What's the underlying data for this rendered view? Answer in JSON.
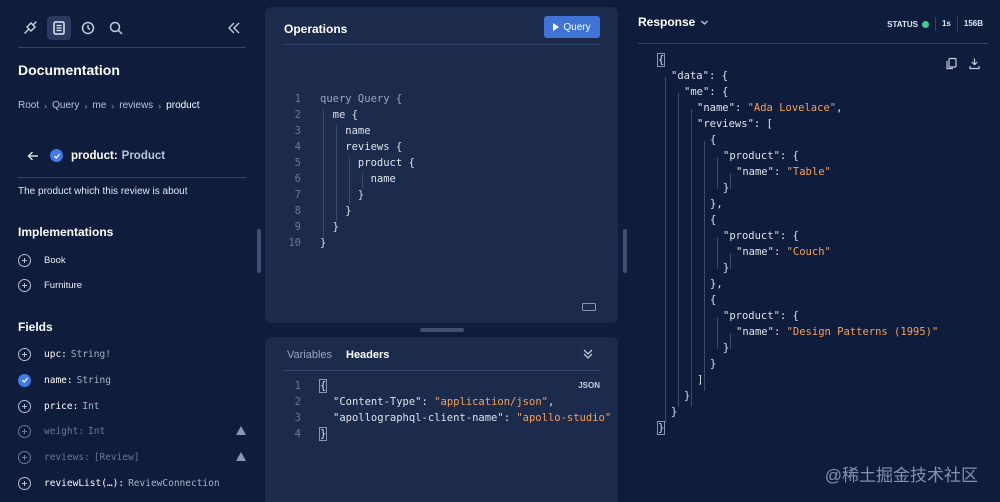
{
  "docs": {
    "toolbar": [
      "explorer-icon",
      "docs-icon",
      "history-icon",
      "search-icon",
      "collapse-icon"
    ],
    "title": "Documentation",
    "breadcrumb": [
      "Root",
      "Query",
      "me",
      "reviews",
      "product"
    ],
    "field": {
      "name": "product",
      "type": "Product"
    },
    "description": "The product which this review is about",
    "implementations_title": "Implementations",
    "implementations": [
      "Book",
      "Furniture"
    ],
    "fields_title": "Fields",
    "fields": [
      {
        "name": "upc:",
        "type": "String!",
        "state": "add"
      },
      {
        "name": "name:",
        "type": "String",
        "state": "selected"
      },
      {
        "name": "price:",
        "type": "Int",
        "state": "add"
      },
      {
        "name": "weight:",
        "type": "Int",
        "state": "deprecated"
      },
      {
        "name": "reviews:",
        "type": "[Review]",
        "state": "deprecated"
      },
      {
        "name": "reviewList(…):",
        "type": "ReviewConnection",
        "state": "add"
      }
    ]
  },
  "operations": {
    "title": "Operations",
    "run_label": "Query",
    "lines": [
      "query Query {",
      "  me {",
      "    name",
      "    reviews {",
      "      product {",
      "        name",
      "      }",
      "    }",
      "  }",
      "}"
    ]
  },
  "variables": {
    "tabs": [
      "Variables",
      "Headers"
    ],
    "active_tab": "Headers",
    "format": "JSON",
    "headers": [
      {
        "key": "\"Content-Type\"",
        "value": "\"application/json\""
      },
      {
        "key": "\"apollographql-client-name\"",
        "value": "\"apollo-studio\""
      }
    ]
  },
  "response": {
    "title": "Response",
    "status_label": "STATUS",
    "status_color": "#3fcf8e",
    "time": "1s",
    "size": "156B",
    "body": {
      "data": {
        "me": {
          "name": "Ada Lovelace",
          "reviews": [
            {
              "product": {
                "name": "Table"
              }
            },
            {
              "product": {
                "name": "Couch"
              }
            },
            {
              "product": {
                "name": "Design Patterns (1995)"
              }
            }
          ]
        }
      }
    }
  },
  "watermark": "@稀土掘金技术社区",
  "colors": {
    "background": "#0f1c3b",
    "panel": "#1c2a4b",
    "accent": "#3f73d6",
    "string": "#f2a25a"
  }
}
